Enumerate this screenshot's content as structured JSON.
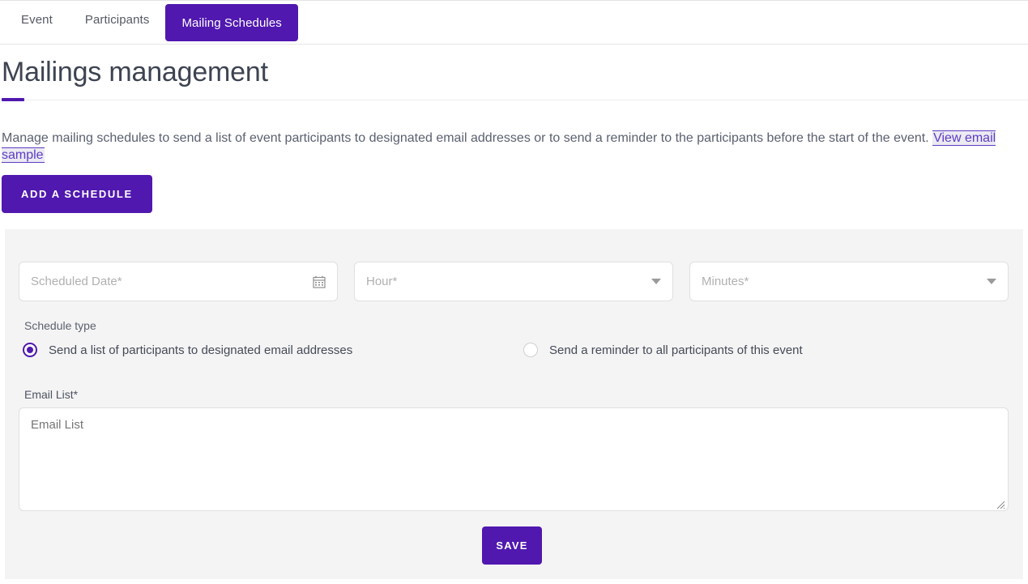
{
  "tabs": [
    {
      "label": "Event",
      "active": false
    },
    {
      "label": "Participants",
      "active": false
    },
    {
      "label": "Mailing Schedules",
      "active": true
    }
  ],
  "page": {
    "title": "Mailings management",
    "description_before": "Manage mailing schedules to send a list of event participants to designated email addresses or to send a reminder to the participants before the start of the event. ",
    "description_link": "View email sample"
  },
  "actions": {
    "add_schedule_label": "ADD A SCHEDULE",
    "save_label": "SAVE"
  },
  "form": {
    "scheduled_date": {
      "placeholder": "Scheduled Date*",
      "value": "",
      "icon": "calendar-icon"
    },
    "hour": {
      "placeholder": "Hour*",
      "value": "",
      "icon": "chevron-down-icon"
    },
    "minutes": {
      "placeholder": "Minutes*",
      "value": "",
      "icon": "chevron-down-icon"
    },
    "schedule_type": {
      "label": "Schedule type",
      "options": [
        {
          "label": "Send a list of participants to designated email addresses",
          "selected": true
        },
        {
          "label": "Send a reminder to all participants of this event",
          "selected": false
        }
      ]
    },
    "email_list": {
      "label": "Email List*",
      "placeholder": "Email List",
      "value": ""
    }
  },
  "colors": {
    "brand_purple": "#5018af",
    "link_purple": "#5c3cc4",
    "panel_gray": "#f4f4f4",
    "text_dark": "#3d4351",
    "text_muted": "#5b6070",
    "placeholder": "#b0b0b0"
  }
}
